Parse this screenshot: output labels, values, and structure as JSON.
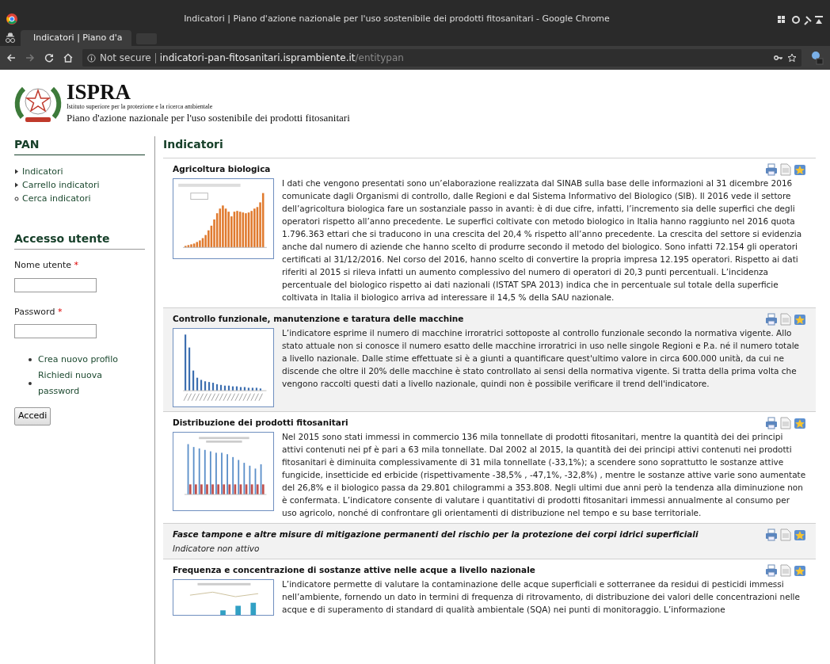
{
  "browser": {
    "window_title": "Indicatori | Piano d'azione nazionale per l'uso sostenibile dei prodotti fitosanitari - Google Chrome",
    "tab_title": "Indicatori | Piano d'a",
    "security_label": "Not secure",
    "url_host": "indicatori-pan-fitosanitari.isprambiente.it",
    "url_path": "/entitypan"
  },
  "header": {
    "org_name": "ISPRA",
    "org_subtitle": "Istituto superiore per la protezione e la ricerca ambientale",
    "site_title": "Piano d'azione nazionale per l'uso sostenibile dei prodotti fitosanitari"
  },
  "sidebar": {
    "menu_title": "PAN",
    "menu_items": [
      {
        "label": "Indicatori",
        "kind": "arrow"
      },
      {
        "label": "Carrello indicatori",
        "kind": "arrow"
      },
      {
        "label": "Cerca indicatori",
        "kind": "circle"
      }
    ],
    "login": {
      "title": "Accesso utente",
      "fields": [
        {
          "label": "Nome utente",
          "required_mark": "*"
        },
        {
          "label": "Password",
          "required_mark": "*"
        }
      ],
      "links": [
        "Crea nuovo profilo",
        "Richiedi nuova password"
      ],
      "submit": "Accedi"
    }
  },
  "main": {
    "title": "Indicatori",
    "indicators": [
      {
        "title": "Agricoltura biologica",
        "active": true,
        "kind": "growth",
        "text": "I dati che vengono presentati sono un’elaborazione realizzata dal SINAB sulla base delle informazioni al 31 dicembre 2016 comunicate dagli Organismi di controllo, dalle Regioni e dal Sistema Informativo del Biologico (SIB). Il 2016 vede il settore dell’agricoltura biologica fare un sostanziale passo in avanti: è di due cifre, infatti, l’incremento sia delle superfici che degli operatori rispetto all’anno precedente. Le superfici coltivate con metodo biologico in Italia hanno raggiunto nel 2016 quota 1.796.363 ettari che si traducono in una crescita del 20,4 % rispetto all’anno precedente. La crescita del settore si evidenzia anche dal numero di aziende che hanno scelto di produrre secondo il metodo del biologico. Sono infatti 72.154 gli operatori certificati al 31/12/2016. Nel corso del 2016, hanno scelto di convertire la propria impresa 12.195 operatori. Rispetto ai dati riferiti al 2015 si rileva infatti un aumento complessivo del numero di operatori di 20,3 punti percentuali. L’incidenza percentuale del biologico rispetto ai dati nazionali (ISTAT SPA 2013) indica che in percentuale sul totale della superficie coltivata in Italia il biologico arriva ad interessare il 14,5 % della SAU nazionale."
      },
      {
        "title": "Controllo funzionale, manutenzione e taratura delle macchine",
        "active": true,
        "kind": "decline",
        "text": "L’indicatore esprime il numero di macchine irroratrici sottoposte al controllo funzionale secondo la normativa vigente. Allo stato attuale non si conosce il numero esatto delle macchine irroratrici in uso nelle singole Regioni e P.a. né il numero totale a livello nazionale. Dalle stime effettuate si è a giunti a quantificare quest'ultimo valore in circa 600.000 unità, da cui ne discende che oltre il 20% delle macchine è stato controllato ai sensi della normativa vigente. Si tratta della prima volta che vengono raccolti questi dati a livello nazionale, quindi non è possibile verificare il trend dell'indicatore."
      },
      {
        "title": "Distribuzione dei prodotti fitosanitari",
        "active": true,
        "kind": "grouped",
        "text": "Nel 2015 sono stati immessi in commercio 136 mila tonnellate di prodotti fitosanitari, mentre la quantità dei dei principi attivi contenuti nei pf è pari a 63 mila tonnellate. Dal 2002 al 2015, la quantità dei dei principi attivi contenuti nei prodotti fitosanitari è diminuita complessivamente di 31 mila tonnellate (-33,1%); a scendere sono soprattutto le sostanze attive fungicide, insetticide ed erbicide (rispettivamente -38,5% , -47,1%, -32,8%) , mentre le sostanze attive varie sono aumentate del 26,8% e il biologico passa da 29.801 chilogrammi a 353.808. Negli ultimi due anni però la tendenza alla diminuzione non è confermata. L’indicatore consente di valutare i quantitativi di prodotti fitosanitari immessi annualmente al consumo per uso agricolo, nonché di confrontare gli orientamenti di distribuzione nel tempo e su base territoriale."
      },
      {
        "title": "Fasce tampone e altre misure di mitigazione permanenti del rischio per la protezione dei corpi idrici superficiali",
        "active": false,
        "kind": "none",
        "text": "Indicatore non attivo"
      },
      {
        "title": "Frequenza e concentrazione di sostanze attive nelle acque a livello nazionale",
        "active": true,
        "kind": "trend",
        "text": "L’indicatore permette di valutare la contaminazione delle acque superficiali e sotterranee da residui di pesticidi immessi nell’ambiente, fornendo un dato in termini di frequenza di ritrovamento, di distribuzione dei valori delle concentrazioni nelle acque e di superamento di standard di qualità ambientale (SQA) nei punti di monitoraggio. L’informazione"
      }
    ]
  }
}
